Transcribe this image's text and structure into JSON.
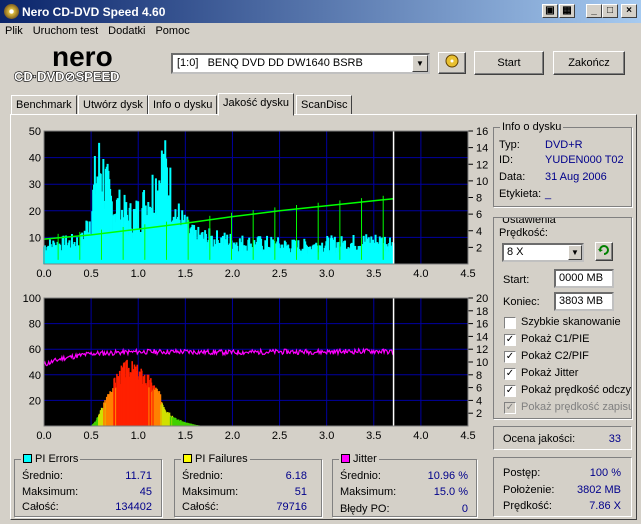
{
  "window": {
    "title": "Nero CD-DVD Speed 4.60"
  },
  "menu": [
    "Plik",
    "Uruchom test",
    "Dodatki",
    "Pomoc"
  ],
  "drive": {
    "selected": "[1:0]   BENQ DVD DD DW1640 BSRB"
  },
  "buttons": {
    "start": "Start",
    "stop": "Zakończ"
  },
  "tabs": [
    "Benchmark",
    "Utwórz dysk",
    "Info o dysku",
    "Jakość dysku",
    "ScanDisc"
  ],
  "disc_info": {
    "title": "Info o dysku",
    "type_label": "Typ:",
    "type_value": "DVD+R",
    "id_label": "ID:",
    "id_value": "YUDEN000 T02",
    "date_label": "Data:",
    "date_value": "31 Aug 2006",
    "label_label": "Etykieta:",
    "label_value": "_"
  },
  "settings": {
    "title": "Ustawienia",
    "speed_label": "Prędkość:",
    "speed_value": "8 X",
    "start_label": "Start:",
    "start_value": "0000 MB",
    "end_label": "Koniec:",
    "end_value": "3803 MB",
    "checkboxes": [
      {
        "label": "Szybkie skanowanie",
        "checked": false,
        "disabled": false
      },
      {
        "label": "Pokaż C1/PIE",
        "checked": true,
        "disabled": false
      },
      {
        "label": "Pokaż C2/PIF",
        "checked": true,
        "disabled": false
      },
      {
        "label": "Pokaż Jitter",
        "checked": true,
        "disabled": false
      },
      {
        "label": "Pokaż prędkość odczytu",
        "checked": true,
        "disabled": false
      },
      {
        "label": "Pokaż prędkość zapisu",
        "checked": true,
        "disabled": true
      }
    ]
  },
  "quality": {
    "label": "Ocena jakości:",
    "value": "33"
  },
  "pi_errors": {
    "title": "PI Errors",
    "color": "#00ffff",
    "avg_label": "Średnio:",
    "avg": "11.71",
    "max_label": "Maksimum:",
    "max": "45",
    "total_label": "Całość:",
    "total": "134402"
  },
  "pi_failures": {
    "title": "PI Failures",
    "color": "#ffff00",
    "avg_label": "Średnio:",
    "avg": "6.18",
    "max_label": "Maksimum:",
    "max": "51",
    "total_label": "Całość:",
    "total": "79716"
  },
  "jitter": {
    "title": "Jitter",
    "color": "#ff00ff",
    "avg_label": "Średnio:",
    "avg": "10.96 %",
    "max_label": "Maksimum:",
    "max": "15.0 %",
    "po_label": "Błędy PO:",
    "po": "0"
  },
  "progress": {
    "progress_label": "Postęp:",
    "progress": "100 %",
    "position_label": "Położenie:",
    "position": "3802 MB",
    "speed_label": "Prędkość:",
    "speed": "7.86 X"
  },
  "chart_data": [
    {
      "type": "area",
      "x_ticks": [
        "0.0",
        "0.5",
        "1.0",
        "1.5",
        "2.0",
        "2.5",
        "3.0",
        "3.5",
        "4.0",
        "4.5"
      ],
      "y_left_ticks": [
        "10",
        "20",
        "30",
        "40",
        "50"
      ],
      "y_right_ticks": [
        "2",
        "4",
        "6",
        "8",
        "10",
        "12",
        "14",
        "16"
      ],
      "xlim": [
        0,
        4.5
      ],
      "ylim_left": [
        0,
        50
      ],
      "ylim_right": [
        0,
        16
      ],
      "end_marker_x": 3.71,
      "series": [
        {
          "name": "PI Errors",
          "color": "#00ffff",
          "x": [
            0,
            0.2,
            0.4,
            0.5,
            0.55,
            0.6,
            0.65,
            0.7,
            0.8,
            0.9,
            1.0,
            1.1,
            1.2,
            1.25,
            1.3,
            1.4,
            1.5,
            1.6,
            1.8,
            2.0,
            2.2,
            2.4,
            2.6,
            2.8,
            3.0,
            3.2,
            3.4,
            3.6,
            3.71
          ],
          "y": [
            8,
            9,
            10,
            22,
            38,
            44,
            36,
            28,
            24,
            20,
            22,
            28,
            36,
            42,
            40,
            22,
            16,
            12,
            11,
            10,
            9,
            9,
            8,
            8,
            9,
            9,
            10,
            10,
            10
          ]
        },
        {
          "name": "Read speed",
          "color": "#00ff00",
          "x": [
            0,
            0.5,
            1.0,
            1.5,
            2.0,
            2.5,
            3.0,
            3.5,
            3.71
          ],
          "y": [
            3.0,
            3.5,
            4.2,
            4.9,
            5.7,
            6.4,
            7.0,
            7.6,
            7.86
          ]
        }
      ]
    },
    {
      "type": "area",
      "x_ticks": [
        "0.0",
        "0.5",
        "1.0",
        "1.5",
        "2.0",
        "2.5",
        "3.0",
        "3.5",
        "4.0",
        "4.5"
      ],
      "y_left_ticks": [
        "20",
        "40",
        "60",
        "80",
        "100"
      ],
      "y_right_ticks": [
        "2",
        "4",
        "6",
        "8",
        "10",
        "12",
        "14",
        "16",
        "18",
        "20"
      ],
      "xlim": [
        0,
        4.5
      ],
      "ylim_left": [
        0,
        100
      ],
      "ylim_right": [
        0,
        20
      ],
      "end_marker_x": 3.71,
      "series": [
        {
          "name": "PI Failures",
          "x": [
            0,
            0.5,
            0.55,
            0.6,
            0.7,
            0.8,
            0.85,
            0.9,
            0.95,
            1.0,
            1.1,
            1.2,
            1.3,
            1.4,
            1.5,
            1.6,
            1.7,
            3.71
          ],
          "y": [
            0,
            0,
            4,
            12,
            30,
            44,
            48,
            51,
            48,
            46,
            40,
            30,
            14,
            6,
            3,
            1,
            0,
            0
          ]
        },
        {
          "name": "Jitter",
          "color": "#ff00ff",
          "x": [
            0,
            0.2,
            0.5,
            1.0,
            1.5,
            2.0,
            2.5,
            3.0,
            3.5,
            3.71
          ],
          "y": [
            9.6,
            10.6,
            11.3,
            11.6,
            11.6,
            11.5,
            11.6,
            11.6,
            11.7,
            11.6
          ]
        }
      ]
    }
  ]
}
